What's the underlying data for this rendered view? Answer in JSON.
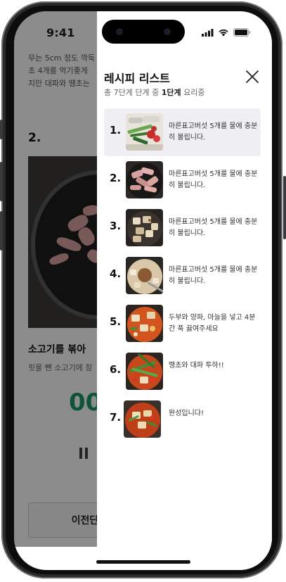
{
  "status_bar": {
    "time": "9:41"
  },
  "background": {
    "text_lines": [
      "무는 5cm 정도 깍둑",
      "초 4개를 먹기좋게",
      "지만 대파와 땡초는"
    ],
    "step_label": "2.",
    "step_title": "소고기를 볶아",
    "step_sub": "핏물 뺀 소고기에 참",
    "timer": "00",
    "prev_button": "이전단"
  },
  "drawer": {
    "title": "레시피 리스트",
    "subtitle_prefix": "총 7단계 단계 중 ",
    "subtitle_bold": "1단계",
    "subtitle_suffix": " 요리중",
    "steps": [
      {
        "num": "1.",
        "desc": "마른표고버섯 5개를 물에 충분히 불립니다.",
        "thumb": "vegetables-photo"
      },
      {
        "num": "2.",
        "desc": "마른표고버섯 5개를 물에 충분히 불립니다.",
        "thumb": "raw-meat-photo"
      },
      {
        "num": "3.",
        "desc": "마른표고버섯 5개를 물에 충분히 불립니다.",
        "thumb": "tofu-pan-photo"
      },
      {
        "num": "4.",
        "desc": "마른표고버섯 5개를 물에 충분히 불립니다.",
        "thumb": "broth-photo"
      },
      {
        "num": "5.",
        "desc": "두부와 양파, 마늘을 넣고 4분간 푹 끓여주세요",
        "thumb": "stew-photo"
      },
      {
        "num": "6.",
        "desc": "땡초와 대파 투하!!",
        "thumb": "scallion-stew-photo"
      },
      {
        "num": "7.",
        "desc": "완성입니다!",
        "thumb": "finished-stew-photo"
      }
    ]
  },
  "colors": {
    "timer": "#1a9c66",
    "active_step_bg": "#efeff4",
    "dim_overlay": "rgba(0,0,0,0.45)"
  }
}
